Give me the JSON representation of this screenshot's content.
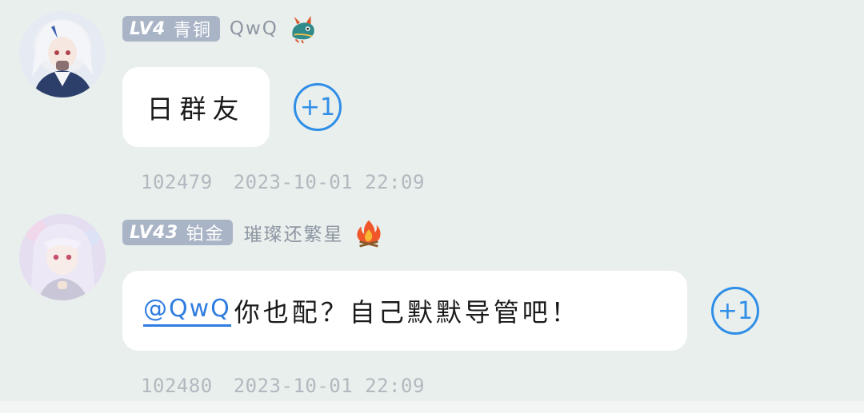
{
  "messages": [
    {
      "badge_level": "LV4",
      "badge_rank": "青铜",
      "username": "QwQ",
      "username_emoji": "dragon-emoji",
      "text": "日群友",
      "plus_label": "+1",
      "message_id": "102479",
      "timestamp": "2023-10-01 22:09"
    },
    {
      "badge_level": "LV43",
      "badge_rank": "铂金",
      "username": "璀璨还繁星",
      "username_emoji": "fire-emoji",
      "mention": "@QwQ",
      "text": "你也配？自己默默导管吧！",
      "plus_label": "+1",
      "message_id": "102480",
      "timestamp": "2023-10-01 22:09"
    }
  ],
  "colors": {
    "background": "#e9efec",
    "badge": "#a9b4c6",
    "accent": "#2f8ee8",
    "mention": "#2f7de0",
    "meta_text": "#b2b8bf"
  }
}
